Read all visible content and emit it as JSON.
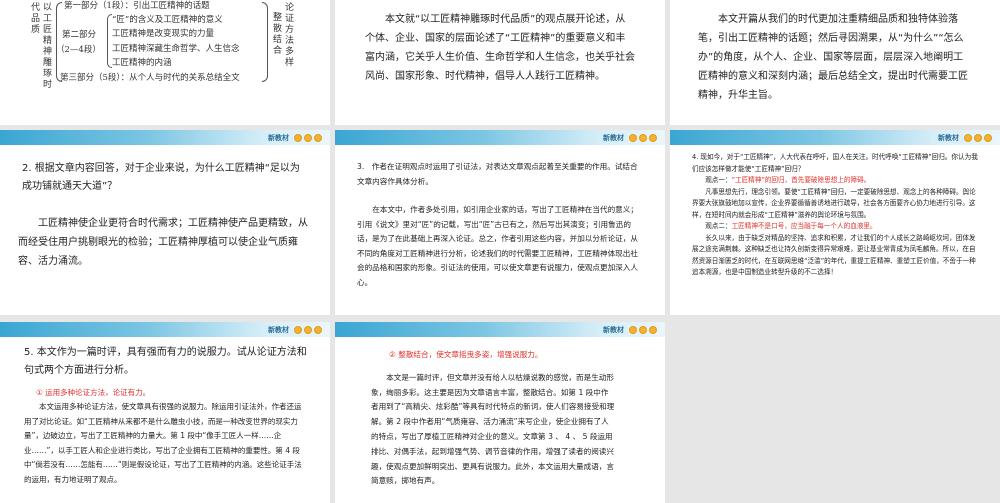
{
  "banner": {
    "label": "新教材"
  },
  "slide1": {
    "left_title": "以工匠精神雕琢时代品质",
    "part1": "第一部分（1段）：引出工匠精神的话题",
    "part2_label": "第二部分",
    "part2_range": "（2—4段）",
    "part2_items": [
      "“匠”的含义及工匠精神的意义",
      "工匠精神是改变现实的力量",
      "工匠精神深藏生命哲学、人生信念",
      "工匠精神的内涵"
    ],
    "part3": "第三部分（5段）：从个人与时代的关系总结全文",
    "right1": "整散结合",
    "right2": "论证方法多样"
  },
  "slide2": {
    "text": "本文就“以工匠精神雕琢时代品质”的观点展开论述，从个体、企业、国家的层面论述了“工匠精神”的重要意义和丰富内涵，它关乎人生价值、生命哲学和人生信念，也关乎社会风尚、国家形象、时代精神，倡导人人践行工匠精神。"
  },
  "slide3": {
    "text": "本文开篇从我们的时代更加注重精细品质和独特体验落笔，引出工匠精神的话题；然后寻因溯果，从“为什么”“怎么办”的角度，从个人、企业、国家等层面，层层深入地阐明工匠精神的意义和深刻内涵；最后总结全文，提出时代需要工匠精神，升华主旨。"
  },
  "slide4": {
    "question": "2. 根据文章内容回答，对于企业来说，为什么工匠精神“足以为成功铺就通天大道”？",
    "answer": "工匠精神使企业更符合时代需求；工匠精神使产品更精致，从而经受住用户挑剔眼光的检验；工匠精神厚植可以使企业气质雍容、活力涌流。"
  },
  "slide5": {
    "question": "3.　作者在证明观点时运用了引证法，对表达文章观点起着至关重要的作用。试结合文章内容作具体分析。",
    "answer": "在本文中，作者多处引用，如引用企业家的话，写出了工匠精神在当代的意义；引用《说文》里对“匠”的记载，写出“匠”古已有之，然后写出其演变；引用鲁迅的话，是为了在此基础上再深入论证。总之，作者引用这些内容，并加以分析论证，从不同的角度对工匠精神进行分析，论述我们的时代需要工匠精神，工匠精神体现出社会的品格和国家的形象。引证法的使用，可以使文章更有说服力，使观点更加深入人心。"
  },
  "slide6": {
    "question": "4. 现如今，对于“工匠精神”，人大代表在呼吁，国人在关注。时代呼唤“工匠精神”回归。你认为我们应该怎样做才能使“工匠精神”回归？",
    "view1_label": "观点一：",
    "view1": "“工匠精神”的回归，首先要破除思想上的障碍。",
    "view1_text": "凡事思想先行，理念引领。要使“工匠精神”回归，一定要破除思想、观念上的各种障碍。舆论界要大张旗鼓地加以宣传，企业界要循循善诱地进行疏导，社会各方面要齐心协力地进行引导。这样，在短时间内就会形成“工匠精神”滋养的舆论环境与氛围。",
    "view2_label": "观点二：",
    "view2": "工匠精神不是口号，应当融于每一个人的血液里。",
    "view2_text": "长久以来，由于缺乏对精品的坚持、追求和积累，才让我们的个人成长之路崎岖坎坷，团体发展之途充满荆棘。这种缺乏也让持久创新变得异常艰难，更让基业常青成为凤毛麟角。所以，在自然资源日渐匮乏的时代，在互联网思维“泛滥”的年代，重提工匠精神、重塑工匠价值，不啻于一种追本溯源，也是中国制造业转型升级的不二选择！"
  },
  "slide7": {
    "question": "5. 本文作为一篇时评，具有强而有力的说服力。试从论证方法和句式两个方面进行分析。",
    "point1": "①  运用多种论证方法，论证有力。",
    "text": "本文运用多种论证方法，使文章具有很强的说服力。除运用引证法外，作者还运用了对比论证。如“工匠精神从来都不是什么雕虫小技，而是一种改变世界的现实力量”，边破边立，写出了工匠精神的力量大。第 1 段中“像手工匠人一样……企业……”，以手工匠人和企业进行类比，写出了企业拥有工匠精神的重要性。第 4 段中“倘若没有……怎能有……”则是假设论证，写出了工匠精神的内涵。这些论证手法的运用，有力地证明了观点。"
  },
  "slide8": {
    "point2": "②  整散结合，使文章摇曳多姿，增强说服力。",
    "text": "本文是一篇时评，但文章并没有给人以枯燥说教的感觉，而是生动形象，绚丽多彩。这主要是因为文章语言丰富，整散结合。如第 1 段中作者用到了“高精尖、炫彩酷”等具有时代特点的新词，使人们容易接受和理解。第 2 段中作者用“气质雍容、活力涌流”来写企业，使企业拥有了人的特点，写出了厚植工匠精神对企业的意义。文章第 3 、 4 、 5 段运用排比、对偶手法，起到增强气势、调节音律的作用，增强了读者的阅读兴趣，使观点更加鲜明突出、更具有说服力。此外，本文运用大量成语，言简意赅，掷地有声。"
  }
}
